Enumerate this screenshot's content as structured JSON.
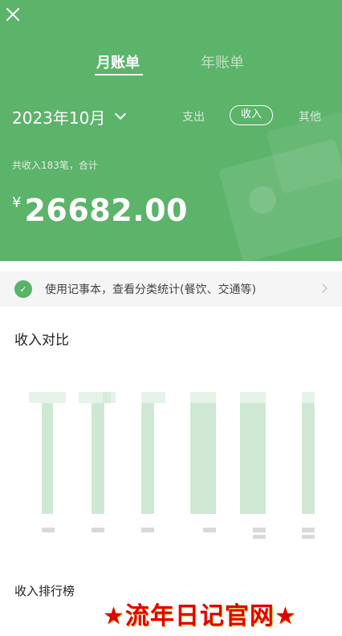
{
  "header": {
    "tabs": [
      "月账单",
      "年账单"
    ],
    "month": "2023年10月",
    "filters": [
      "支出",
      "收入",
      "其他"
    ],
    "summary": "共收入183笔，合计",
    "currency": "¥",
    "amount": "26682.00"
  },
  "promo": {
    "icon": "ledger-icon",
    "text": "使用记事本，查看分类统计(餐饮、交通等)"
  },
  "sections": {
    "compare_title": "收入对比",
    "rank_title": "收入排行榜"
  },
  "watermark": "★流年日记官网★",
  "colors": {
    "header_green": "#5cb36a",
    "bar_green": "#cfe8d3"
  }
}
